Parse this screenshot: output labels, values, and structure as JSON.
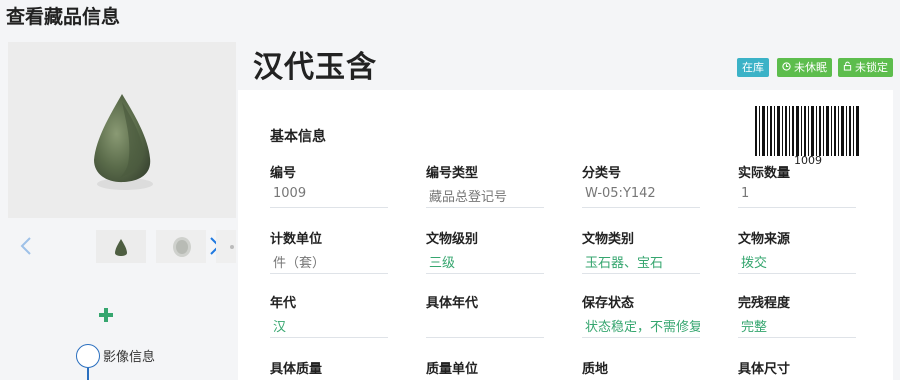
{
  "page": {
    "title": "查看藏品信息"
  },
  "gallery": {
    "main_image_alt": "汉代玉含",
    "thumbnails": [
      "thumb-1",
      "thumb-2",
      "thumb-3"
    ],
    "prev_icon": "chevron-left-icon",
    "next_icon": "chevron-right-icon",
    "add_icon": "plus-icon",
    "image_info_label": "影像信息"
  },
  "item": {
    "title": "汉代玉含",
    "tags": {
      "instock": "在库",
      "sleep": "未休眠",
      "lock": "未锁定"
    },
    "tag_colors": {
      "instock": "#3bb2c7",
      "sleep": "#5dbd4d",
      "lock": "#5dbd4d"
    }
  },
  "info": {
    "section_title": "基本信息",
    "barcode_number": "1009",
    "rows": [
      [
        {
          "label": "编号",
          "value": "1009"
        },
        {
          "label": "编号类型",
          "value": "藏品总登记号"
        },
        {
          "label": "分类号",
          "value": "W-05:Y142"
        },
        {
          "label": "实际数量",
          "value": "1"
        }
      ],
      [
        {
          "label": "计数单位",
          "value": "件（套）"
        },
        {
          "label": "文物级别",
          "value": "三级"
        },
        {
          "label": "文物类别",
          "value": "玉石器、宝石"
        },
        {
          "label": "文物来源",
          "value": "拨交"
        }
      ],
      [
        {
          "label": "年代",
          "value": "汉"
        },
        {
          "label": "具体年代",
          "value": ""
        },
        {
          "label": "保存状态",
          "value": "状态稳定，不需修复"
        },
        {
          "label": "完残程度",
          "value": "完整"
        }
      ],
      [
        {
          "label": "具体质量",
          "value": ""
        },
        {
          "label": "质量单位",
          "value": ""
        },
        {
          "label": "质地",
          "value": ""
        },
        {
          "label": "具体尺寸",
          "value": ""
        }
      ]
    ]
  },
  "colors": {
    "accent_green": "#36a66f",
    "link_blue": "#1f79e0"
  }
}
